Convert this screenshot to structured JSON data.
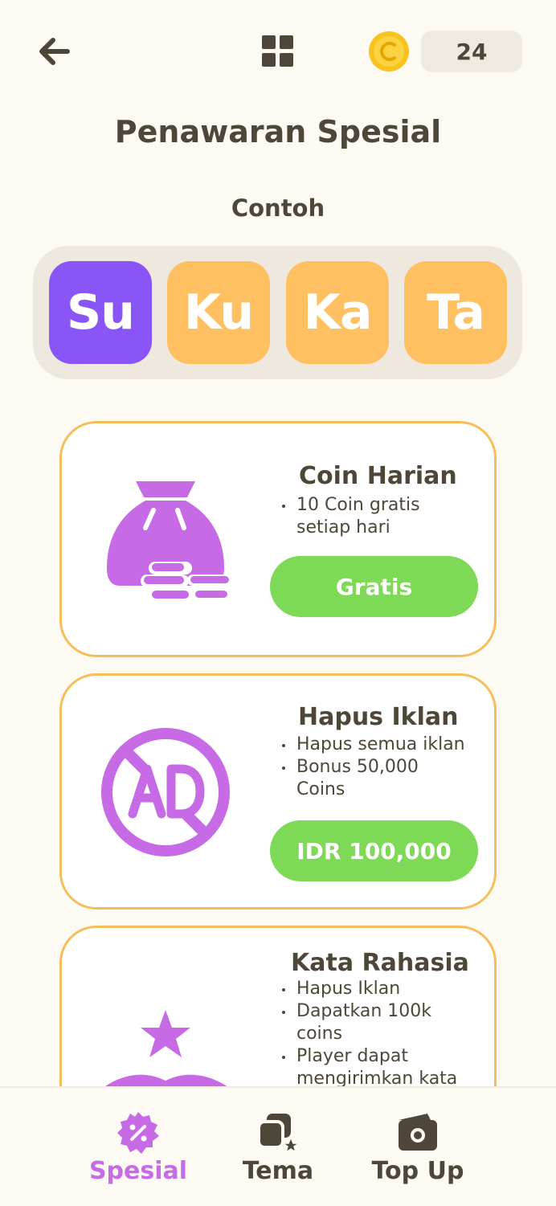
{
  "header": {
    "back_icon": "arrow-left-icon",
    "grid_icon": "grid-icon",
    "coin_icon": "coin-icon",
    "coin_count": "24"
  },
  "page": {
    "title": "Penawaran Spesial",
    "example_label": "Contoh"
  },
  "tiles": [
    {
      "text": "Su",
      "color": "#8A55F7"
    },
    {
      "text": "Ku",
      "color": "#FFC061"
    },
    {
      "text": "Ka",
      "color": "#FFC061"
    },
    {
      "text": "Ta",
      "color": "#FFC061"
    }
  ],
  "offers": [
    {
      "title": "Coin Harian",
      "bullets": [
        "10 Coin gratis",
        "setiap hari"
      ],
      "button": "Gratis",
      "icon": "money-bag-icon"
    },
    {
      "title": "Hapus Iklan",
      "bullets": [
        "Hapus semua iklan",
        "Bonus 50,000",
        "Coins"
      ],
      "button": "IDR 100,000",
      "icon": "no-ads-icon"
    },
    {
      "title": "Kata Rahasia",
      "bullets": [
        "Hapus Iklan",
        "Dapatkan 100k",
        "coins",
        "Player dapat",
        "mengirimkan kata"
      ],
      "icon": "star-book-icon"
    }
  ],
  "bottom_nav": [
    {
      "label": "Spesial",
      "icon": "discount-badge-icon",
      "active": true
    },
    {
      "label": "Tema",
      "icon": "theme-icon",
      "active": false
    },
    {
      "label": "Top Up",
      "icon": "wallet-icon",
      "active": false
    }
  ],
  "colors": {
    "accent": "#C76AE6",
    "button_green": "#7ED957",
    "card_border": "#F6BE5B",
    "text_dark": "#4E4639"
  }
}
